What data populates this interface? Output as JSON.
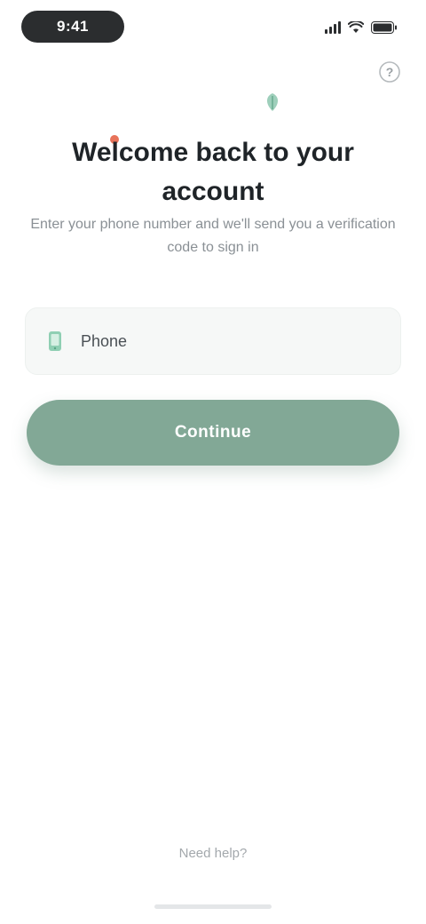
{
  "status_bar": {
    "time": "9:41",
    "signal_icon": "signal-icon",
    "wifi_icon": "wifi-icon",
    "battery_icon": "battery-icon"
  },
  "header": {
    "help_icon": "help-icon",
    "help_glyph": "?"
  },
  "hero": {
    "title": "Welcome back to your account",
    "subtitle": "Enter your phone number and we'll send you a verification code to sign in",
    "accent_color": "#e8735a",
    "leaf_icon": "leaf-icon"
  },
  "phone_field": {
    "icon": "phone-icon",
    "placeholder": "Phone",
    "value": ""
  },
  "continue_button": {
    "label": "Continue",
    "color": "#82a896"
  },
  "footer": {
    "link_text": "Need help?"
  }
}
